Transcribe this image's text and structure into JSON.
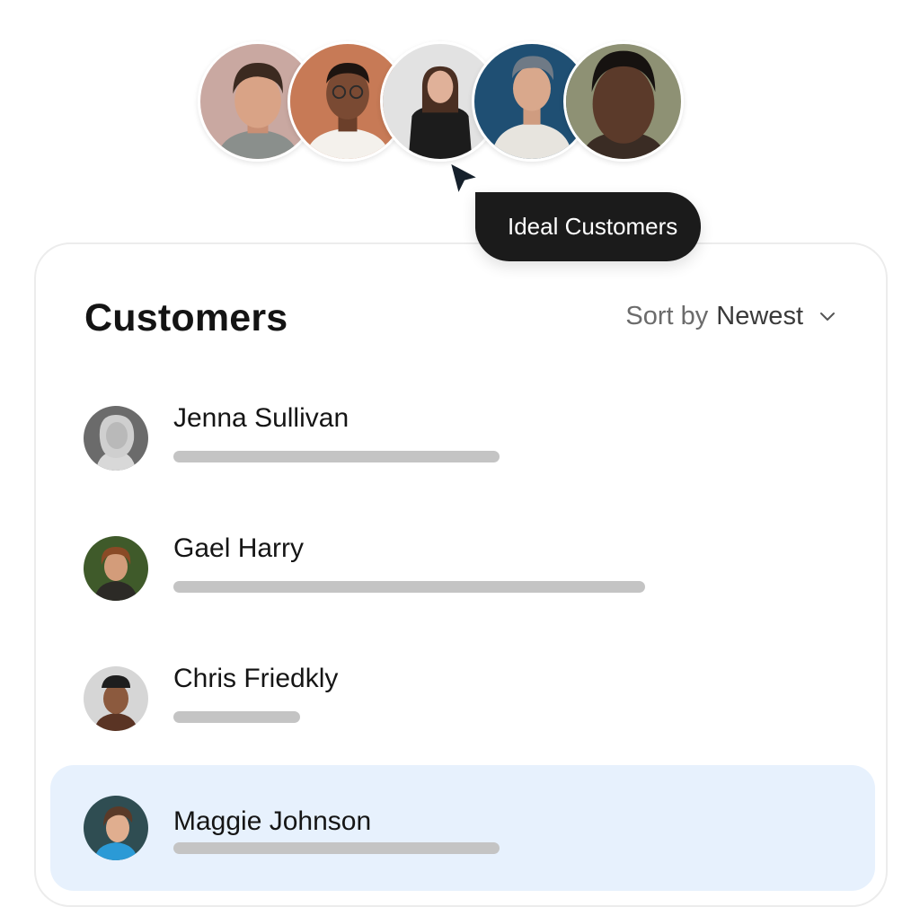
{
  "tooltip": {
    "label": "Ideal Customers"
  },
  "card": {
    "title": "Customers",
    "sort": {
      "prefix": "Sort by",
      "value": "Newest",
      "icon": "chevron-down-icon"
    }
  },
  "customers": [
    {
      "name": "Jenna Sullivan",
      "detail_fill": 0.49
    },
    {
      "name": "Gael Harry",
      "detail_fill": 0.71
    },
    {
      "name": "Chris Friedkly",
      "detail_fill": 0.19
    },
    {
      "name": "Maggie Johnson",
      "detail_fill": 0.49,
      "selected": true
    }
  ],
  "colors": {
    "tooltip_bg": "#1b1b1b",
    "selected_row_bg": "#e7f1fd",
    "placeholder_bar": "#c4c4c4"
  }
}
